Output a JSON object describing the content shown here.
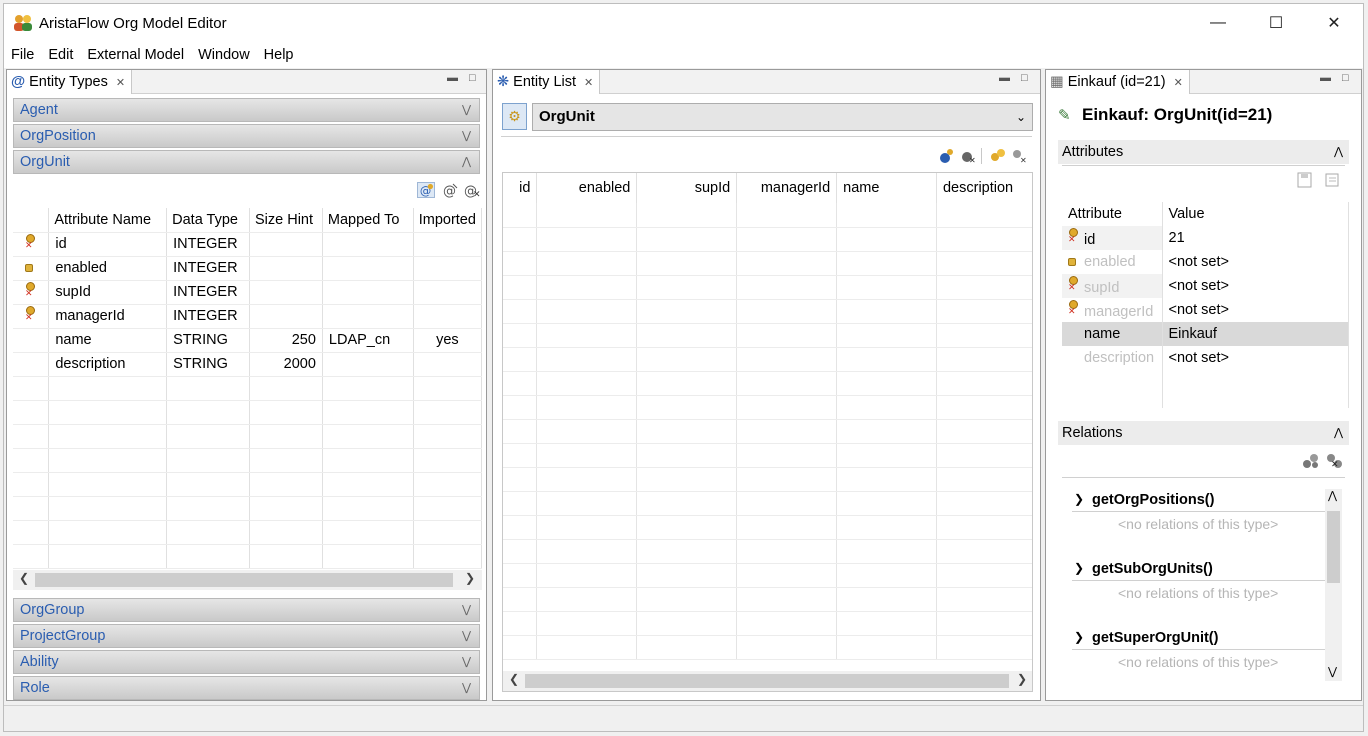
{
  "window": {
    "title": "AristaFlow Org Model Editor"
  },
  "menu": [
    "File",
    "Edit",
    "External Model",
    "Window",
    "Help"
  ],
  "entity_types": {
    "tab_label": "Entity Types",
    "groups_top": [
      "Agent",
      "OrgPosition",
      "OrgUnit"
    ],
    "groups_bottom": [
      "OrgGroup",
      "ProjectGroup",
      "Ability",
      "Role"
    ],
    "columns": [
      "Attribute Name",
      "Data Type",
      "Size Hint",
      "Mapped To",
      "Imported"
    ],
    "rows": [
      {
        "icon": "key-icon",
        "name": "id",
        "type": "INTEGER",
        "size": "",
        "mapped": "",
        "imported": ""
      },
      {
        "icon": "lock-icon",
        "name": "enabled",
        "type": "INTEGER",
        "size": "",
        "mapped": "",
        "imported": ""
      },
      {
        "icon": "key-icon",
        "name": "supId",
        "type": "INTEGER",
        "size": "",
        "mapped": "",
        "imported": ""
      },
      {
        "icon": "key-icon",
        "name": "managerId",
        "type": "INTEGER",
        "size": "",
        "mapped": "",
        "imported": ""
      },
      {
        "icon": "",
        "name": "name",
        "type": "STRING",
        "size": "250",
        "mapped": "LDAP_cn",
        "imported": "yes"
      },
      {
        "icon": "",
        "name": "description",
        "type": "STRING",
        "size": "2000",
        "mapped": "",
        "imported": ""
      }
    ]
  },
  "entity_list": {
    "tab_label": "Entity List",
    "selected_type": "OrgUnit",
    "columns": [
      "id",
      "enabled",
      "supId",
      "managerId",
      "name",
      "description"
    ]
  },
  "details": {
    "tab_label": "Einkauf (id=21)",
    "heading": "Einkauf: OrgUnit(id=21)",
    "attributes_label": "Attributes",
    "attr_col": "Attribute",
    "value_col": "Value",
    "attributes": [
      {
        "icon": "key-icon",
        "name": "id",
        "value": "21",
        "muted": false
      },
      {
        "icon": "lock-icon",
        "name": "enabled",
        "value": "<not set>",
        "muted": true
      },
      {
        "icon": "key-icon",
        "name": "supId",
        "value": "<not set>",
        "muted": true
      },
      {
        "icon": "key-icon",
        "name": "managerId",
        "value": "<not set>",
        "muted": true
      },
      {
        "icon": "",
        "name": "name",
        "value": "Einkauf",
        "muted": false
      },
      {
        "icon": "",
        "name": "description",
        "value": "<not set>",
        "muted": true
      }
    ],
    "relations_label": "Relations",
    "relations": [
      {
        "name": "getOrgPositions()",
        "empty": "<no relations of this type>"
      },
      {
        "name": "getSubOrgUnits()",
        "empty": "<no relations of this type>"
      },
      {
        "name": "getSuperOrgUnit()",
        "empty": "<no relations of this type>"
      }
    ]
  }
}
